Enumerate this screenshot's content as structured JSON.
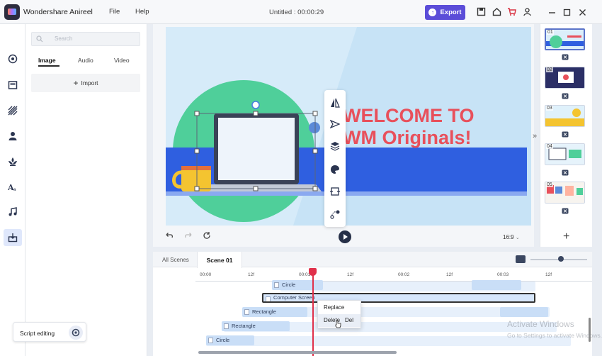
{
  "app": {
    "name": "Wondershare Anireel",
    "menu": [
      "File",
      "Help"
    ],
    "doc_title": "Untitled : 00:00:29",
    "export_label": "Export",
    "colors": {
      "accent": "#5b4dd8",
      "playhead": "#e0304a",
      "welcome_text": "#e8505b",
      "band_blue": "#2f5fe0"
    }
  },
  "rail": {
    "icons": [
      "scene-icon",
      "layout-icon",
      "background-icon",
      "character-icon",
      "props-icon",
      "text-icon",
      "music-icon",
      "import-media-icon"
    ]
  },
  "library": {
    "search_placeholder": "Search",
    "tabs": [
      "Image",
      "Audio",
      "Video"
    ],
    "import_label": "Import",
    "script_editing": "Script editing"
  },
  "canvas": {
    "headline_1": "WELCOME TO",
    "headline_2": "WM Originals!",
    "aspect_ratio": "16:9"
  },
  "scenes": {
    "numbers": [
      "01",
      "02",
      "03",
      "04",
      "05"
    ],
    "add_label": "+"
  },
  "timeline": {
    "tabs": [
      "All Scenes",
      "Scene 01"
    ],
    "ruler_labels": [
      "00:00",
      "12f",
      "00:01",
      "12f",
      "00:02",
      "12f",
      "00:03",
      "12f"
    ],
    "tracks": [
      "Circle",
      "Computer Screen",
      "Rectangle",
      "Rectangle",
      "Circle"
    ],
    "context_menu": [
      {
        "label": "Replace",
        "shortcut": ""
      },
      {
        "label": "Delete",
        "shortcut": "Del"
      }
    ]
  },
  "watermark": {
    "line1": "Activate Windows",
    "line2": "Go to Settings to activate Windows."
  }
}
